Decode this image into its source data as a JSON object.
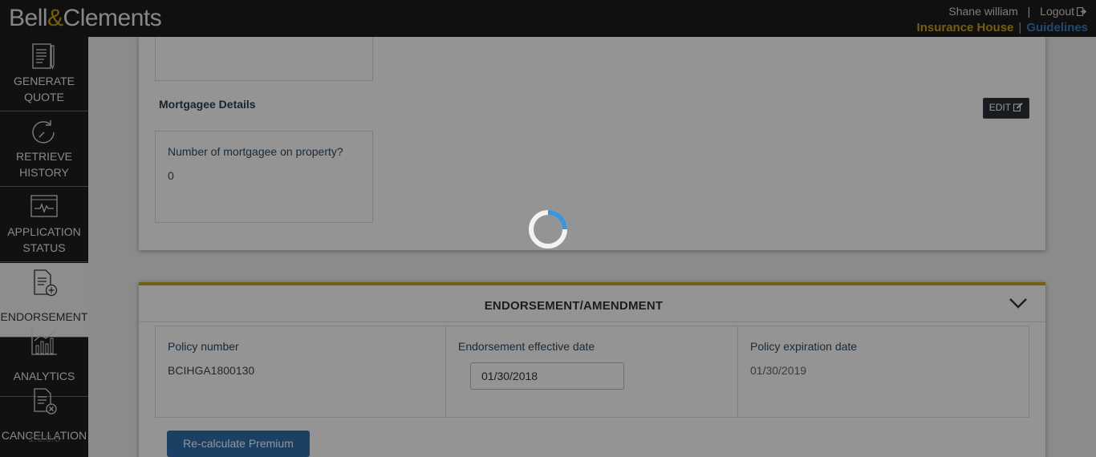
{
  "header": {
    "logo_part1": "Bell",
    "logo_amp": "&",
    "logo_part2": "Clements",
    "user_name": "Shane william",
    "separator": "|",
    "logout_label": "Logout",
    "insurance_house_link": "Insurance House",
    "guidelines_link": "Guidelines"
  },
  "sidebar": {
    "items": [
      {
        "label_line1": "GENERATE",
        "label_line2": "QUOTE",
        "icon": "document-pen-icon"
      },
      {
        "label_line1": "RETRIEVE",
        "label_line2": "HISTORY",
        "icon": "history-clock-icon"
      },
      {
        "label_line1": "APPLICATION",
        "label_line2": "STATUS",
        "icon": "monitor-pulse-icon"
      },
      {
        "label_line1": "ENDORSEMENT",
        "icon": "document-plus-icon",
        "active": true
      },
      {
        "label_line1": "ANALYTICS",
        "icon": "bar-chart-icon"
      },
      {
        "label_line1": "CANCELLATION",
        "icon": "document-cancel-icon"
      }
    ],
    "version": "1.0.0.8"
  },
  "mortgagee": {
    "section_title": "Mortgagee Details",
    "edit_label": "EDIT",
    "question": "Number of mortgagee on property?",
    "answer": "0"
  },
  "endorsement": {
    "title": "ENDORSEMENT/AMENDMENT",
    "policy_number_label": "Policy number",
    "policy_number_value": "BCIHGA1800130",
    "effective_date_label": "Endorsement effective date",
    "effective_date_value": "01/30/2018",
    "expiration_date_label": "Policy expiration date",
    "expiration_date_value": "01/30/2019",
    "recalculate_label": "Re-calculate Premium"
  },
  "colors": {
    "accent_gold": "#c9a31c",
    "link_blue": "#3a7fc2",
    "spinner_blue": "#3d95d8",
    "button_blue": "#2f6fad"
  },
  "loading": {
    "spinner_progress": 0.25
  }
}
